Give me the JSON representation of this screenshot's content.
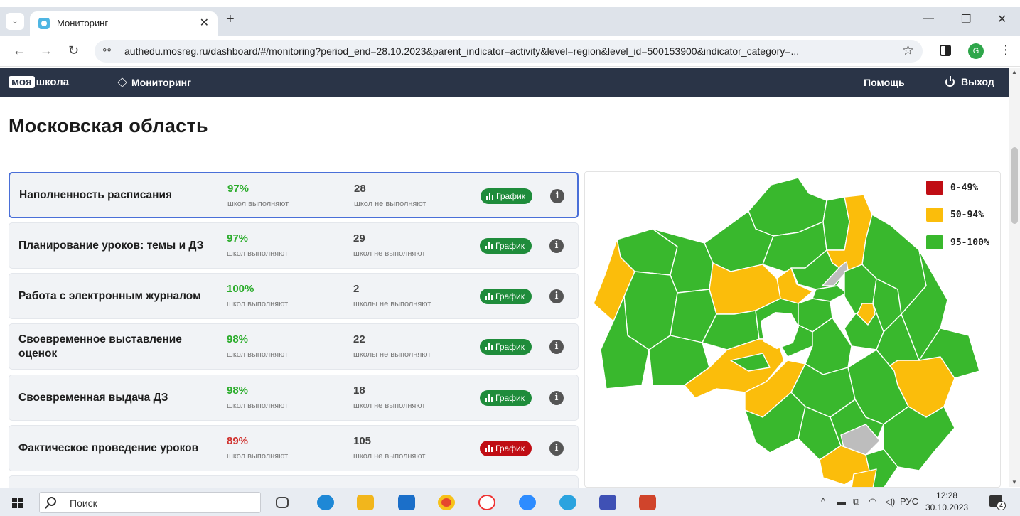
{
  "browser": {
    "tab_title": "Мониторинг",
    "url": "authedu.mosreg.ru/dashboard/#/monitoring?period_end=28.10.2023&parent_indicator=activity&level=region&level_id=500153900&indicator_category=..."
  },
  "header": {
    "logo_part1": "моя",
    "logo_part2": "школа",
    "nav_monitoring": "Мониторинг",
    "help": "Помощь",
    "exit": "Выход"
  },
  "page_title": "Московская область",
  "indicators": [
    {
      "label": "Наполненность расписания",
      "percent": "97%",
      "percent_caption": "школ выполняют",
      "count": "28",
      "count_caption": "школ не выполняют",
      "button": "График",
      "status": "green"
    },
    {
      "label": "Планирование уроков: темы и ДЗ",
      "percent": "97%",
      "percent_caption": "школ выполняют",
      "count": "29",
      "count_caption": "школ не выполняют",
      "button": "График",
      "status": "green"
    },
    {
      "label": "Работа с электронным журналом",
      "percent": "100%",
      "percent_caption": "школ выполняют",
      "count": "2",
      "count_caption": "школы не выполняют",
      "button": "График",
      "status": "green"
    },
    {
      "label": "Своевременное выставление оценок",
      "percent": "98%",
      "percent_caption": "школ выполняют",
      "count": "22",
      "count_caption": "школы не выполняют",
      "button": "График",
      "status": "green"
    },
    {
      "label": "Своевременная выдача ДЗ",
      "percent": "98%",
      "percent_caption": "школ выполняют",
      "count": "18",
      "count_caption": "школ не выполняют",
      "button": "График",
      "status": "green"
    },
    {
      "label": "Фактическое проведение уроков",
      "percent": "89%",
      "percent_caption": "школ выполняют",
      "count": "105",
      "count_caption": "школ не выполняют",
      "button": "График",
      "status": "red"
    }
  ],
  "map": {
    "legend": [
      {
        "label": "0-49%",
        "color": "#c00d14"
      },
      {
        "label": "50-94%",
        "color": "#fbbd0b"
      },
      {
        "label": "95-100%",
        "color": "#39b82d"
      }
    ],
    "no_data_color": "#bdbdbd"
  },
  "taskbar": {
    "search": "Поиск",
    "lang": "РУС",
    "time": "12:28",
    "date": "30.10.2023",
    "notifications": "4"
  }
}
